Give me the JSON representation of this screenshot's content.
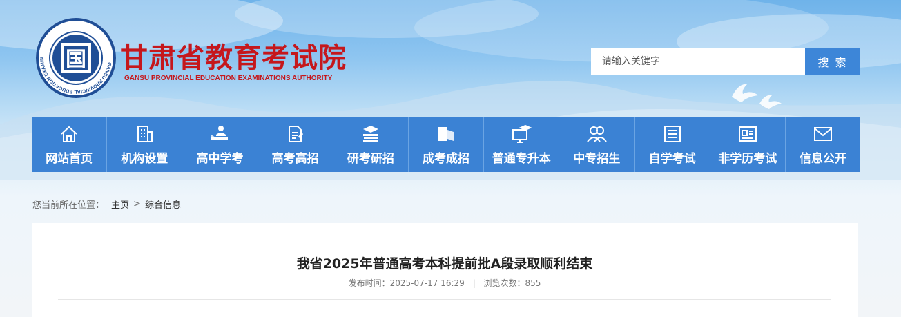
{
  "header": {
    "title": "甘肃省教育考试院",
    "subtitle": "GANSU PROVINCIAL EDUCATION EXAMINATIONS AUTHORITY",
    "emblem_char": "国",
    "emblem_ring_text": "GANSU PROVINCIAL EDUCATION EXAMINATIONS AUTHORITY",
    "emblem_top_text": "甘肃省教育考试院"
  },
  "search": {
    "placeholder": "请输入关键字",
    "button_label": "搜 索"
  },
  "nav": {
    "items": [
      {
        "label": "网站首页",
        "icon": "home-icon"
      },
      {
        "label": "机构设置",
        "icon": "building-icon"
      },
      {
        "label": "高中学考",
        "icon": "student-desk-icon"
      },
      {
        "label": "高考高招",
        "icon": "document-pen-icon"
      },
      {
        "label": "研考研招",
        "icon": "books-graduation-icon"
      },
      {
        "label": "成考成招",
        "icon": "book-open-icon"
      },
      {
        "label": "普通专升本",
        "icon": "monitor-graduation-icon"
      },
      {
        "label": "中专招生",
        "icon": "people-icon"
      },
      {
        "label": "自学考试",
        "icon": "notebook-icon"
      },
      {
        "label": "非学历考试",
        "icon": "certificate-icon"
      },
      {
        "label": "信息公开",
        "icon": "envelope-icon"
      }
    ]
  },
  "breadcrumb": {
    "prefix": "您当前所在位置：",
    "home": "主页",
    "separator": ">",
    "current": "综合信息"
  },
  "article": {
    "title": "我省2025年普通高考本科提前批A段录取顺利结束",
    "publish_label": "发布时间：2025-07-17 16:29",
    "separator": "|",
    "views_label": "浏览次数：855"
  },
  "colors": {
    "brand_red": "#c5171c",
    "nav_blue": "#3b82d4",
    "button_blue": "#3d86d8",
    "emblem_blue": "#1f4e96"
  }
}
